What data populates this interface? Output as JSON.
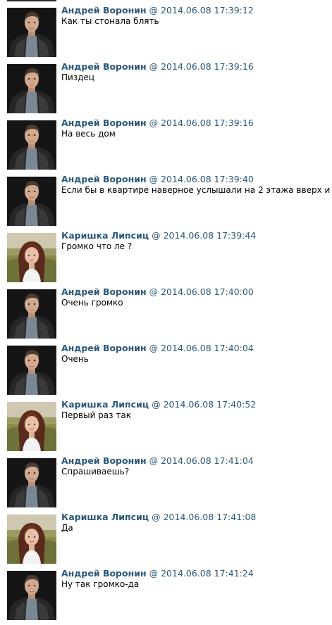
{
  "messages": [
    {
      "author": "Андрей Воронин",
      "at": "@",
      "time": "2014.06.08 17:39:12",
      "text": "Как ты стонала блять",
      "avatar": "andrey-avatar"
    },
    {
      "author": "Андрей Воронин",
      "at": "@",
      "time": "2014.06.08 17:39:16",
      "text": "Пиздец",
      "avatar": "andrey-avatar"
    },
    {
      "author": "Андрей Воронин",
      "at": "@",
      "time": "2014.06.08 17:39:16",
      "text": "На весь дом",
      "avatar": "andrey-avatar"
    },
    {
      "author": "Андрей Воронин",
      "at": "@",
      "time": "2014.06.08 17:39:40",
      "text": "Если бы в квартире наверное услышали на 2 этажа вверх и в",
      "avatar": "andrey-avatar"
    },
    {
      "author": "Каришка Липсиц",
      "at": "@",
      "time": "2014.06.08 17:39:44",
      "text": "Громко что ле ?",
      "avatar": "karishka-avatar"
    },
    {
      "author": "Андрей Воронин",
      "at": "@",
      "time": "2014.06.08 17:40:00",
      "text": "Очень громко",
      "avatar": "andrey-avatar"
    },
    {
      "author": "Андрей Воронин",
      "at": "@",
      "time": "2014.06.08 17:40:04",
      "text": "Очень",
      "avatar": "andrey-avatar"
    },
    {
      "author": "Каришка Липсиц",
      "at": "@",
      "time": "2014.06.08 17:40:52",
      "text": "Первый раз так",
      "avatar": "karishka-avatar"
    },
    {
      "author": "Андрей Воронин",
      "at": "@",
      "time": "2014.06.08 17:41:04",
      "text": "Спрашиваешь?",
      "avatar": "andrey-avatar"
    },
    {
      "author": "Каришка Липсиц",
      "at": "@",
      "time": "2014.06.08 17:41:08",
      "text": "Да",
      "avatar": "karishka-avatar"
    },
    {
      "author": "Андрей Воронин",
      "at": "@",
      "time": "2014.06.08 17:41:24",
      "text": "Ну так громко-да",
      "avatar": "andrey-avatar"
    }
  ],
  "colors": {
    "author": "#2b587a",
    "text": "#000000",
    "background": "#ffffff"
  }
}
